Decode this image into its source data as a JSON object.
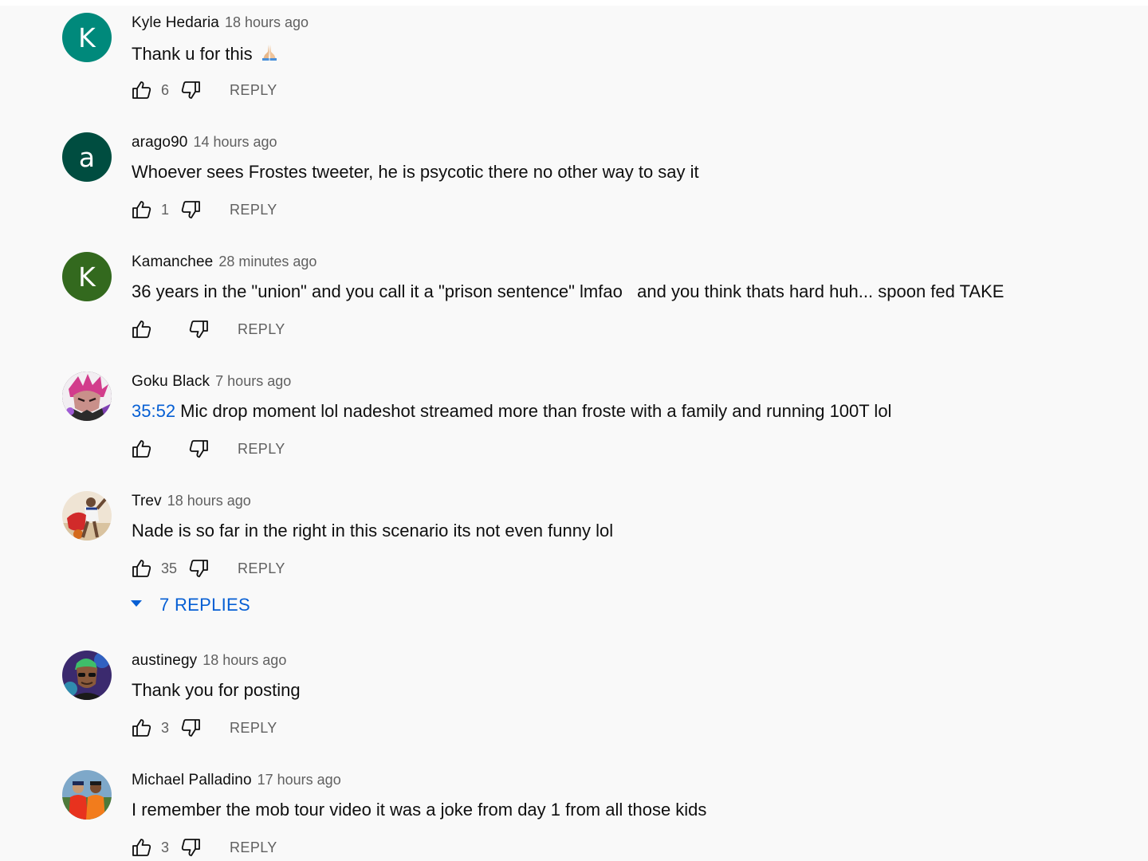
{
  "comments": [
    {
      "author": "Kyle Hedaria",
      "time": "18 hours ago",
      "text": "Thank u for this",
      "emoji": "folded-hands",
      "likes": "6",
      "avatar_letter": "K",
      "avatar_color": "#00897b",
      "reply_label": "REPLY"
    },
    {
      "author": "arago90",
      "time": "14 hours ago",
      "text": "Whoever sees Frostes tweeter, he is psycotic there no other way to say it",
      "likes": "1",
      "avatar_letter": "a",
      "avatar_color": "#004d40",
      "reply_label": "REPLY"
    },
    {
      "author": "Kamanchee",
      "time": "28 minutes ago",
      "text": "36 years in the \"union\" and you call it a \"prison sentence\" lmfao   and you think thats hard huh... spoon fed TAKE",
      "likes": "",
      "avatar_letter": "K",
      "avatar_color": "#33691e",
      "reply_label": "REPLY"
    },
    {
      "author": "Goku Black",
      "time": "7 hours ago",
      "timestamp": "35:52",
      "text": " Mic drop moment lol nadeshot streamed more than froste with a family and running 100T lol",
      "likes": "",
      "avatar_icon": "goku-black-avatar-icon",
      "reply_label": "REPLY"
    },
    {
      "author": "Trev",
      "time": "18 hours ago",
      "text": "Nade is so far in the right in this scenario its not even funny lol",
      "likes": "35",
      "avatar_icon": "basketball-player-avatar-icon",
      "reply_label": "REPLY",
      "replies_label": "7 REPLIES"
    },
    {
      "author": "austinegy",
      "time": "18 hours ago",
      "text": "Thank you for posting",
      "likes": "3",
      "avatar_icon": "portrait-avatar-icon",
      "reply_label": "REPLY"
    },
    {
      "author": "Michael Palladino",
      "time": "17 hours ago",
      "text": "I remember the mob tour video it was a joke from day 1 from all those kids",
      "likes": "3",
      "avatar_icon": "two-people-avatar-icon",
      "reply_label": "REPLY"
    }
  ],
  "colors": {
    "link_blue": "#065fd4",
    "secondary_text": "#606060",
    "primary_text": "#0f0f0f",
    "background": "#f9f9f9"
  }
}
